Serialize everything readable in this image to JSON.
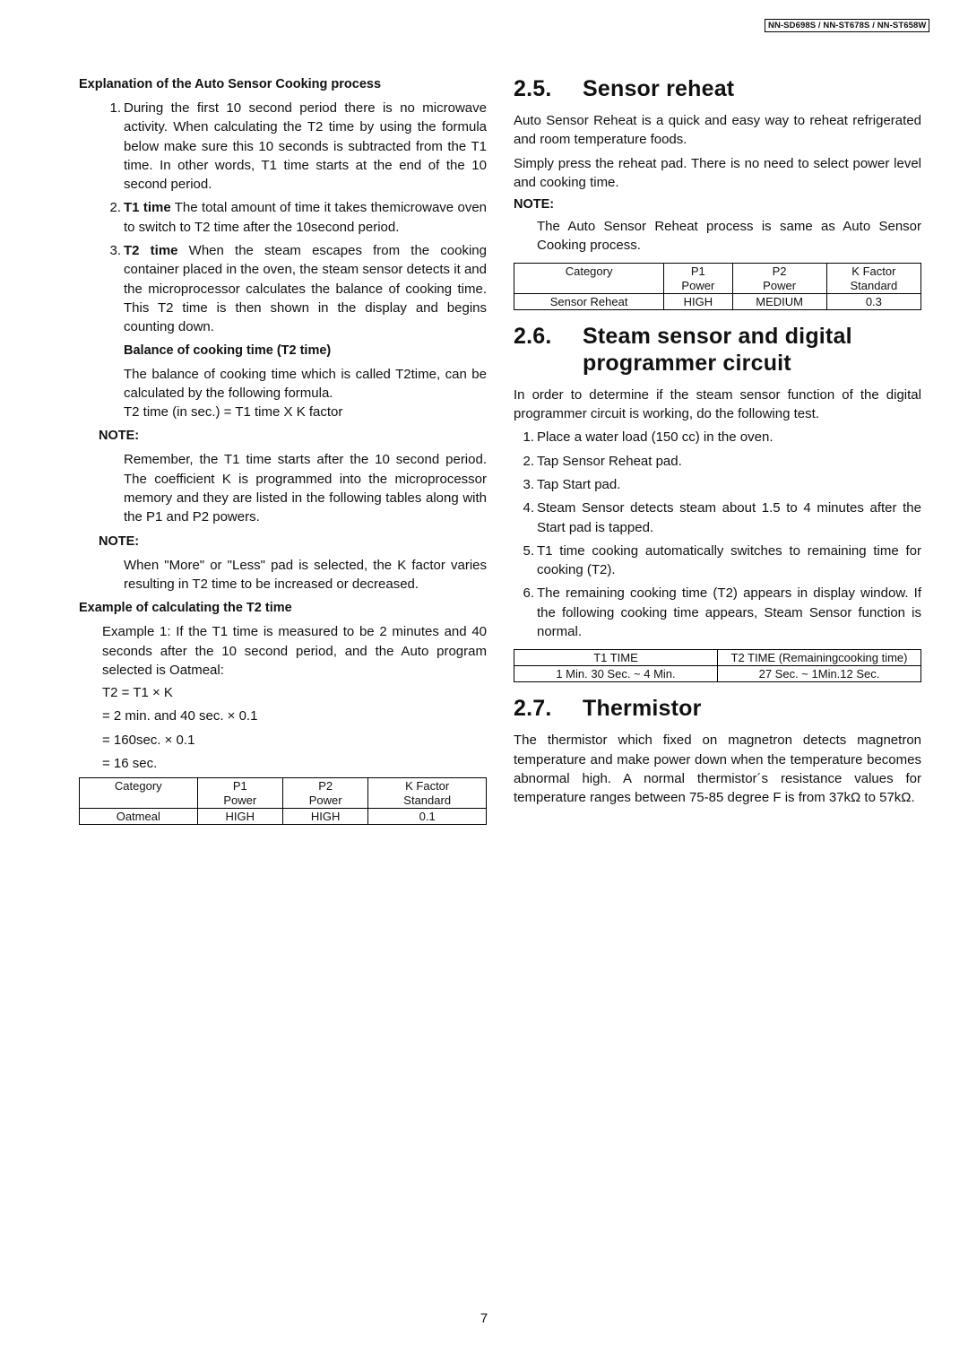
{
  "header": {
    "model_numbers": "NN-SD698S / NN-ST678S / NN-ST658W"
  },
  "left_column": {
    "explanation_heading": "Explanation of the Auto Sensor Cooking process",
    "items": [
      {
        "num": "1.",
        "lead": "",
        "text": "During the first 10 second period there is no microwave activity. When calculating the T2 time by using the formula below make sure this 10 seconds is subtracted from the T1 time. In other words, T1 time starts at the end of the 10 second period."
      },
      {
        "num": "2.",
        "lead": "T1 time",
        "text": " The total amount of time it takes themicrowave oven to switch to T2 time after the 10second period."
      },
      {
        "num": "3.",
        "lead": "T2 time",
        "text": " When the steam escapes from the cooking container placed in the oven, the steam sensor detects it and the microprocessor calculates the balance of cooking time. This T2 time is then shown in the display and begins counting down."
      }
    ],
    "balance_heading": "Balance of cooking time (T2 time)",
    "balance_text": "The balance of cooking time which is called T2time, can be calculated by the following formula.",
    "formula": "T2 time (in sec.) = T1 time X K factor",
    "note1_label": "NOTE:",
    "note1_text": "Remember, the T1 time starts after the 10 second period. The coefficient K is programmed into the microprocessor memory and they are listed in the following tables along with the P1 and P2 powers.",
    "note2_label": "NOTE:",
    "note2_text": "When \"More\" or \"Less\" pad is selected, the K factor varies resulting in T2 time to be increased or decreased.",
    "example_heading": "Example of calculating the T2 time",
    "example_text": "Example 1: If the T1 time is measured to be 2 minutes and 40 seconds after the 10 second period, and the Auto program selected is Oatmeal:",
    "calc_lines": [
      "T2 = T1 × K",
      "= 2 min. and 40 sec. × 0.1",
      "= 160sec. × 0.1",
      "= 16 sec."
    ],
    "table": {
      "headers": [
        [
          "Category",
          ""
        ],
        [
          "P1",
          "Power"
        ],
        [
          "P2",
          "Power"
        ],
        [
          "K Factor",
          "Standard"
        ]
      ],
      "rows": [
        [
          "Oatmeal",
          "HIGH",
          "HIGH",
          "0.1"
        ]
      ]
    }
  },
  "right_column": {
    "section_25": {
      "number": "2.5.",
      "title": "Sensor reheat",
      "para1": "Auto Sensor Reheat is a quick and easy way to reheat refrigerated and room temperature foods.",
      "para2": "Simply press the reheat pad. There is no need to select power level and cooking time.",
      "note_label": "NOTE:",
      "note_text": "The Auto Sensor Reheat process is same as Auto Sensor Cooking process.",
      "table": {
        "headers": [
          [
            "Category",
            ""
          ],
          [
            "P1",
            "Power"
          ],
          [
            "P2",
            "Power"
          ],
          [
            "K Factor",
            "Standard"
          ]
        ],
        "rows": [
          [
            "Sensor Reheat",
            "HIGH",
            "MEDIUM",
            "0.3"
          ]
        ]
      }
    },
    "section_26": {
      "number": "2.6.",
      "title_line1": "Steam sensor and digital",
      "title_line2": "programmer circuit",
      "intro": "In order to determine if the steam sensor function of the digital programmer circuit is working, do the following test.",
      "steps": [
        {
          "num": "1.",
          "text": "Place a water load (150 cc) in the oven."
        },
        {
          "num": "2.",
          "text": "Tap Sensor Reheat pad."
        },
        {
          "num": "3.",
          "text": "Tap Start pad."
        },
        {
          "num": "4.",
          "text": "Steam Sensor detects steam about 1.5 to 4 minutes after the Start pad is tapped."
        },
        {
          "num": "5.",
          "text": "T1 time cooking automatically switches to remaining time for cooking (T2)."
        },
        {
          "num": "6.",
          "text": "The remaining cooking time (T2) appears in display window. If the following cooking time appears, Steam Sensor function is normal."
        }
      ],
      "table": {
        "headers": [
          "T1 TIME",
          "T2 TIME (Remainingcooking time)"
        ],
        "rows": [
          [
            "1 Min. 30 Sec. ~ 4 Min.",
            "27 Sec. ~ 1Min.12 Sec."
          ]
        ]
      }
    },
    "section_27": {
      "number": "2.7.",
      "title": "Thermistor",
      "text": "The thermistor which fixed on magnetron detects magnetron temperature and make power down when the temperature becomes abnormal high. A normal thermistor´s resistance values for temperature ranges between 75-85 degree F is from 37kΩ to 57kΩ."
    }
  },
  "footer": {
    "page_number": "7"
  }
}
